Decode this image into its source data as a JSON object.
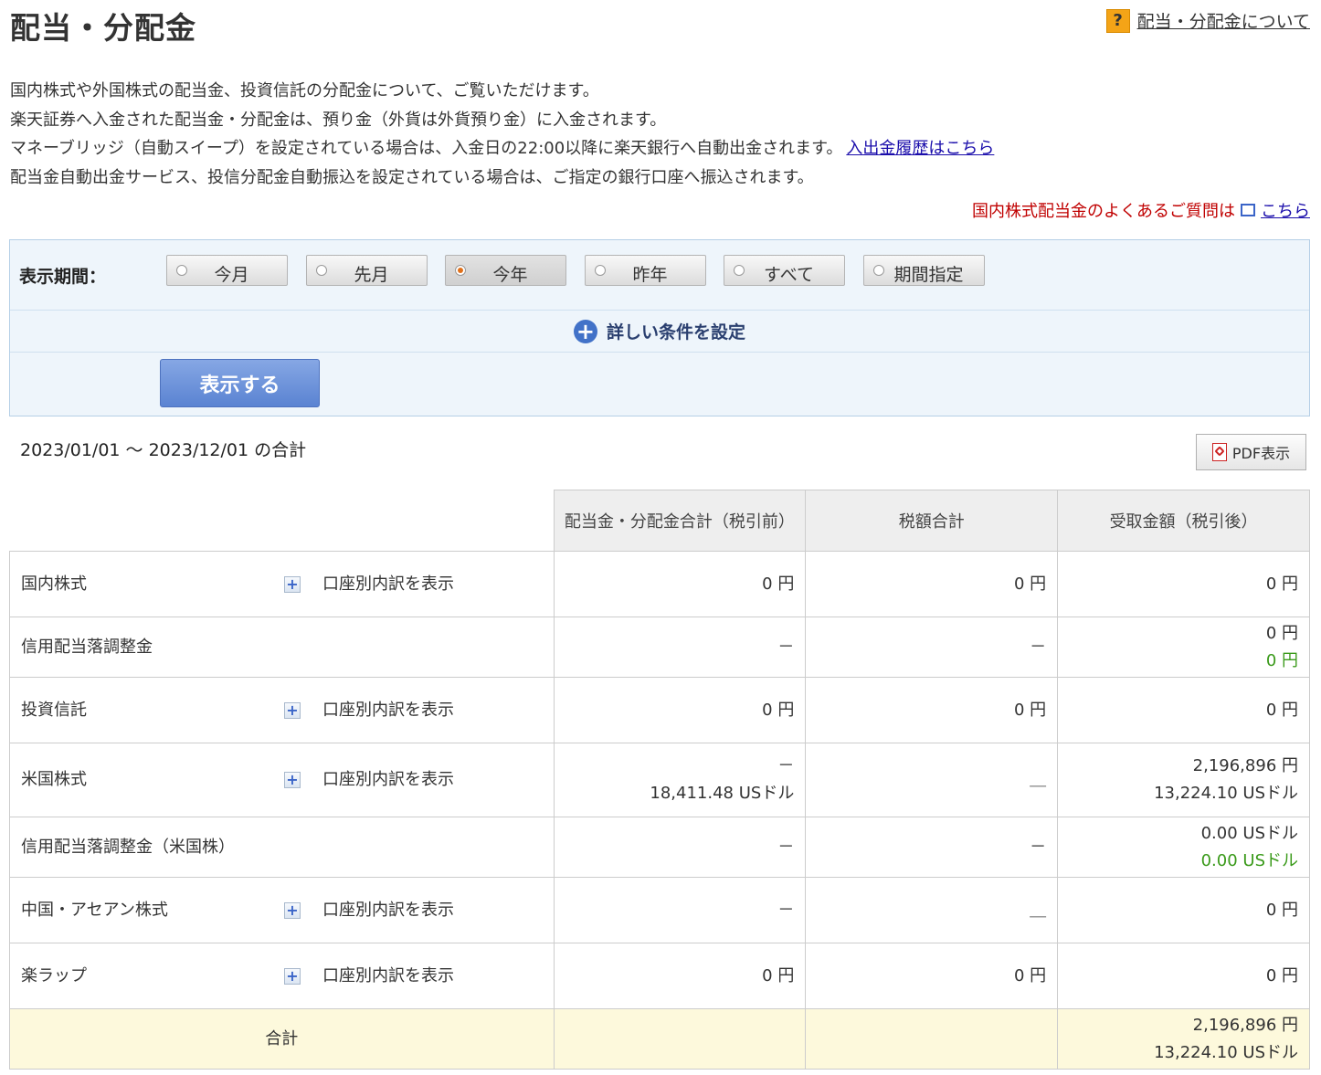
{
  "title": "配当・分配金",
  "help": {
    "icon": "?",
    "link": "配当・分配金について"
  },
  "intro": {
    "line1": "国内株式や外国株式の配当金、投資信託の分配金について、ご覧いただけます。",
    "line2": "楽天証券へ入金された配当金・分配金は、預り金（外貨は外貨預り金）に入金されます。",
    "line3": "マネーブリッジ（自動スイープ）を設定されている場合は、入金日の22:00以降に楽天銀行へ自動出金されます。",
    "line3_link": "入出金履歴はこちら",
    "line4": "配当金自動出金サービス、投信分配金自動振込を設定されている場合は、ご指定の銀行口座へ振込されます。"
  },
  "faq": {
    "text": "国内株式配当金のよくあるご質問は",
    "link": "こちら"
  },
  "filter": {
    "label": "表示期間：",
    "options": [
      "今月",
      "先月",
      "今年",
      "昨年",
      "すべて",
      "期間指定"
    ],
    "selected_index": 2,
    "advanced": "詳しい条件を設定",
    "submit": "表示する"
  },
  "period_text": "2023/01/01 〜 2023/12/01 の合計",
  "pdf_button": "PDF表示",
  "table": {
    "headers": [
      "配当金・分配金合計（税引前）",
      "税額合計",
      "受取金額（税引後）"
    ],
    "expand_label": "口座別内訳を表示",
    "rows": [
      {
        "name": "国内株式",
        "pre": [
          "0 円"
        ],
        "tax": [
          "0 円"
        ],
        "post": [
          "0 円"
        ]
      },
      {
        "name": "信用配当落調整金",
        "pre": [
          "－"
        ],
        "tax": [
          "－"
        ],
        "post": [
          "0 円"
        ],
        "post_green": "0 円"
      },
      {
        "name": "投資信託",
        "pre": [
          "0 円"
        ],
        "tax": [
          "0 円"
        ],
        "post": [
          "0 円"
        ]
      },
      {
        "name": "米国株式",
        "pre": [
          "－",
          "18,411.48 USドル"
        ],
        "tax": [
          "＿"
        ],
        "post": [
          "2,196,896 円",
          "13,224.10 USドル"
        ]
      },
      {
        "name": "信用配当落調整金（米国株）",
        "pre": [
          "－"
        ],
        "tax": [
          "－"
        ],
        "post": [
          "0.00 USドル"
        ],
        "post_green": "0.00 USドル"
      },
      {
        "name": "中国・アセアン株式",
        "pre": [
          "－"
        ],
        "tax": [
          "＿"
        ],
        "post": [
          "0 円"
        ]
      },
      {
        "name": "楽ラップ",
        "pre": [
          "0 円"
        ],
        "tax": [
          "0 円"
        ],
        "post": [
          "0 円"
        ]
      }
    ],
    "total": {
      "name": "合計",
      "post": [
        "2,196,896 円",
        "13,224.10 USドル"
      ]
    }
  }
}
